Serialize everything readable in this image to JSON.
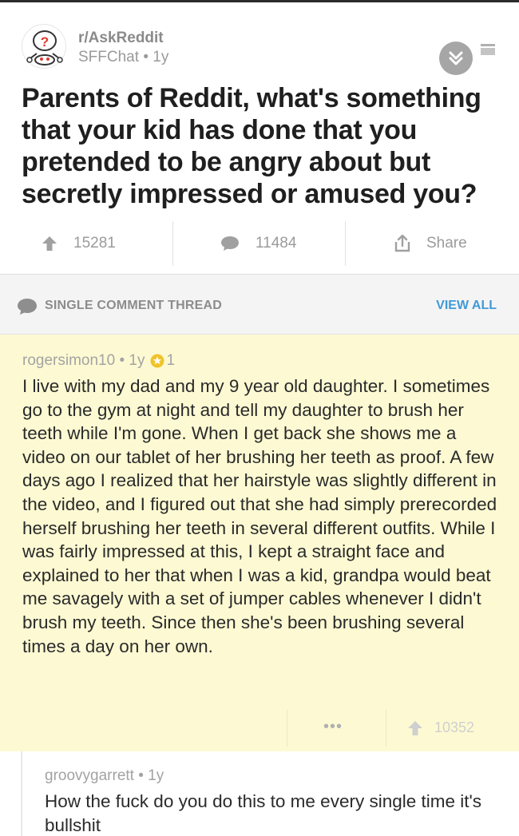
{
  "post": {
    "subreddit": "r/AskReddit",
    "author": "SFFChat",
    "age": "1y",
    "title": "Parents of Reddit, what's something that your kid has done that you pretended to be angry about but secretly impressed or amused you?",
    "upvotes": "15281",
    "comments": "11484",
    "share_label": "Share"
  },
  "thread": {
    "label": "SINGLE COMMENT THREAD",
    "view_all": "VIEW ALL"
  },
  "comment": {
    "author": "rogersimon10",
    "age": "1y",
    "gilded": "1",
    "body": "I live with my dad and my 9 year old daughter. I sometimes go to the gym at night and tell my daughter to brush her teeth while I'm gone. When I get back she shows me a video on our tablet of her brushing her teeth as proof. A few days ago I realized that her hairstyle was slightly different in the video, and I figured out that she had simply prerecorded herself brushing her teeth in several different outfits. While I was fairly impressed at this, I kept a straight face and explained to her that when I was a kid, grandpa would beat me savagely with a set of jumper cables whenever I didn't brush my teeth. Since then she's been brushing several times a day on her own.",
    "more": "•••",
    "score": "10352"
  },
  "reply": {
    "author": "groovygarrett",
    "age": "1y",
    "body": "How the fuck do you do this to me every single time it's bullshit"
  },
  "icons": {
    "avatar": "askreddit-snoo-icon",
    "collapse": "double-chevron-down-icon",
    "save": "bookmark-icon",
    "upvote": "upvote-arrow-icon",
    "comment": "speech-bubble-icon",
    "share": "share-icon",
    "gilded": "gold-star-icon"
  },
  "colors": {
    "accent_link": "#3f9ad8",
    "comment_highlight": "#fdfad3",
    "gilded": "#f0c32b"
  }
}
